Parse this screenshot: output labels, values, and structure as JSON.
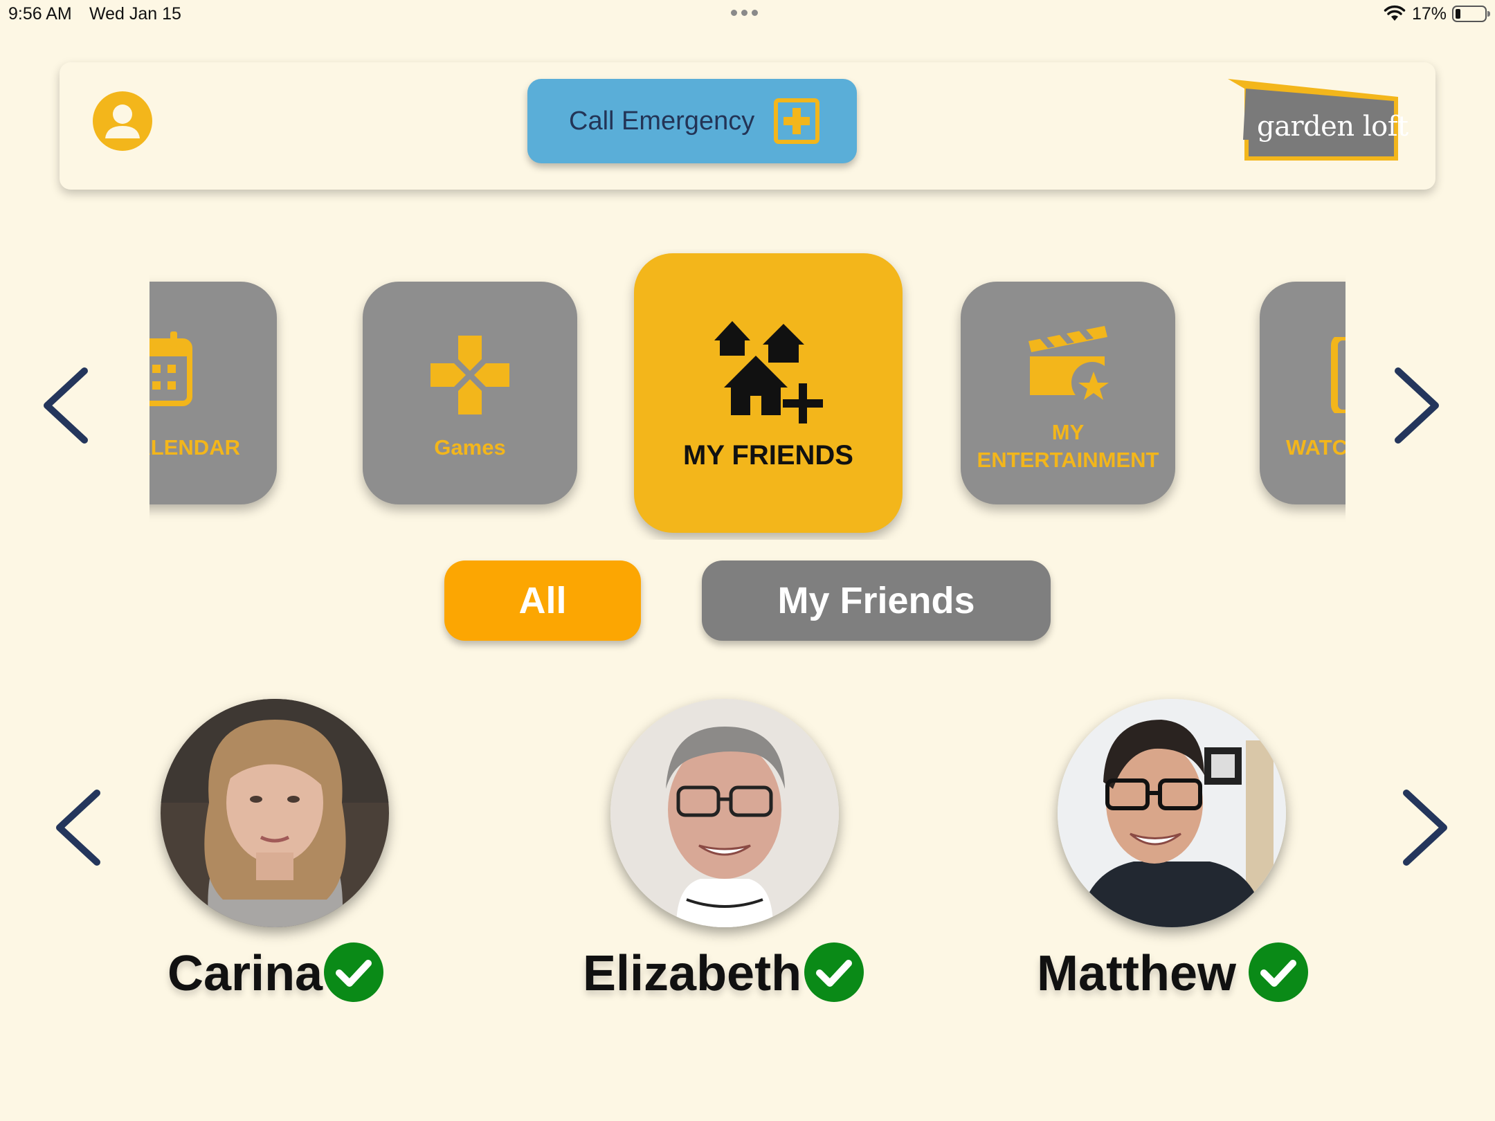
{
  "status_bar": {
    "time": "9:56 AM",
    "date": "Wed Jan 15",
    "battery": "17%"
  },
  "header": {
    "call_emergency_label": "Call Emergency",
    "logo_text": "garden loft"
  },
  "carousel": {
    "tiles": [
      {
        "label": "CALENDAR",
        "icon": "calendar-icon"
      },
      {
        "label": "Games",
        "icon": "gamepad-icon"
      },
      {
        "label": "MY FRIENDS",
        "icon": "friends-houses-icon",
        "active": true
      },
      {
        "label_line1": "MY",
        "label_line2": "ENTERTAINMENT",
        "icon": "clapperboard-star-icon"
      },
      {
        "label": "WATCH",
        "icon": "watch-icon"
      }
    ]
  },
  "filters": {
    "all_label": "All",
    "my_friends_label": "My Friends",
    "selected": "All"
  },
  "friends": [
    {
      "name": "Carina",
      "status": "online"
    },
    {
      "name": "Elizabeth",
      "status": "online"
    },
    {
      "name": "Matthew",
      "status": "online"
    }
  ],
  "colors": {
    "background": "#fdf7e4",
    "accent_yellow": "#f3b61b",
    "tile_gray": "#8e8e8e",
    "emergency_blue": "#5aaed8",
    "pill_orange": "#fca602",
    "arrow_navy": "#24365c",
    "check_green": "#0a8a17"
  }
}
